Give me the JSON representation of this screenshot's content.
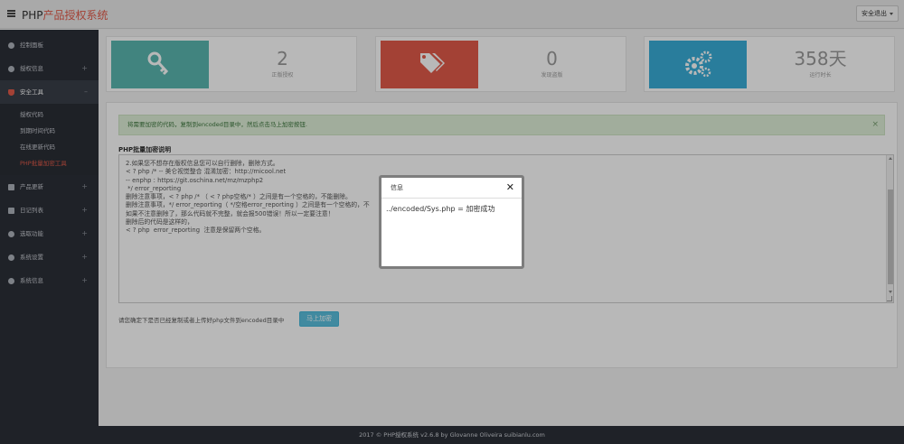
{
  "header": {
    "brand_prefix": "PHP",
    "brand_suffix": "产品授权系统",
    "logout_label": "安全退出"
  },
  "sidebar": {
    "items": [
      {
        "label": "控制面板",
        "icon": "dashboard-icon",
        "has_arrow": false
      },
      {
        "label": "授权信息",
        "icon": "user-icon",
        "has_arrow": true
      },
      {
        "label": "安全工具",
        "icon": "shield-icon",
        "has_arrow": true,
        "expanded": true
      }
    ],
    "subitems": [
      {
        "label": "授权代码"
      },
      {
        "label": "到期时间代码"
      },
      {
        "label": "在线更新代码"
      },
      {
        "label": "PHP批量加密工具",
        "current": true
      }
    ],
    "items_after": [
      {
        "label": "产品更新",
        "icon": "tag-icon",
        "has_arrow": true
      },
      {
        "label": "日记列表",
        "icon": "calendar-icon",
        "has_arrow": true
      },
      {
        "label": "选取功能",
        "icon": "settings-icon",
        "has_arrow": true
      },
      {
        "label": "系统设置",
        "icon": "gears-icon",
        "has_arrow": true
      },
      {
        "label": "系统信息",
        "icon": "info-icon",
        "has_arrow": true
      }
    ]
  },
  "stats": [
    {
      "value": "2",
      "label": "正版授权",
      "color": "#5bb8b1",
      "icon": "key-icon"
    },
    {
      "value": "0",
      "label": "发现盗版",
      "color": "#e25b4a",
      "icon": "tags-icon"
    },
    {
      "value": "358天",
      "label": "运行时长",
      "color": "#3aaed8",
      "icon": "gears-icon"
    }
  ],
  "alert": {
    "text": "将需要加密的代码，复制到encoded目录中，然后点击马上加密按钮.",
    "close": "×"
  },
  "desc": {
    "label": "PHP批量加密说明",
    "lines": [
      "2.如果您不想存在版权信息您可以自行删除，删除方式。",
      "",
      "< ? php /* -- 美仑视觉整合 混淆加密：http://micool.net",
      "-- enphp : https://git.oschina.net/mz/mzphp2",
      " */ error_reporting",
      "",
      "删除注意事项，< ? php /* （ < ? php空格/* ）之间是有一个空格的，不能删除。",
      "删除注意事项，*/ error_reporting（ */空格error_reporting ）之间是有一个空格的，不",
      "",
      "如果不注意删除了，那么代码就不完整，就会报500错误！所以一定要注意！",
      "",
      "删除后的代码是这样的，",
      "< ? php  error_reporting  注意是保留两个空格。"
    ]
  },
  "confirm": {
    "text": "请您确定下是否已经复制或者上传好php文件到encoded目录中",
    "button": "马上加密"
  },
  "footer": {
    "text": "2017 © PHP授权系统 v2.6.8 by Glovanne Oliveira suibianlu.com"
  },
  "dialog": {
    "title": "信息",
    "close": "✕",
    "message": "../encoded/Sys.php = 加密成功"
  },
  "colors": {
    "sidebar_bg": "#2c3038",
    "accent": "#e25b4a",
    "teal": "#5bb8b1",
    "red": "#e25b4a",
    "blue": "#3aaed8",
    "button": "#5bc0de"
  }
}
